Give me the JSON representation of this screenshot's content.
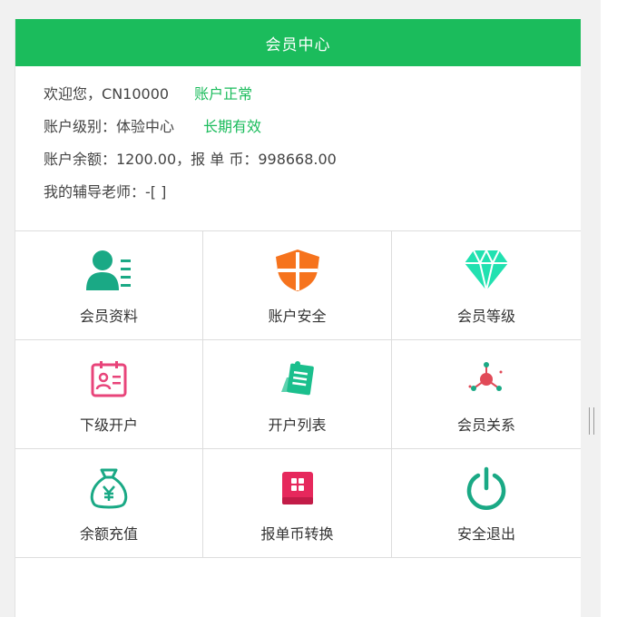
{
  "header": {
    "title": "会员中心"
  },
  "account": {
    "welcome_prefix": "欢迎您，",
    "username": "CN10000",
    "status": "账户正常",
    "level_label": "账户级别：",
    "level_value": "体验中心",
    "validity": "长期有效",
    "balance_text": "账户余额：1200.00，报 单 币：998668.00",
    "mentor_text": "我的辅导老师：-[ ]"
  },
  "menu": {
    "items": [
      {
        "label": "会员资料",
        "icon": "member-profile-icon",
        "color": "#1aa985"
      },
      {
        "label": "账户安全",
        "icon": "shield-icon",
        "color": "#f6731d"
      },
      {
        "label": "会员等级",
        "icon": "diamond-icon",
        "color": "#21e1b0"
      },
      {
        "label": "下级开户",
        "icon": "id-card-icon",
        "color": "#e8447a"
      },
      {
        "label": "开户列表",
        "icon": "notebook-list-icon",
        "color": "#1bbf8d"
      },
      {
        "label": "会员关系",
        "icon": "network-nodes-icon",
        "color": "#e14a58"
      },
      {
        "label": "余额充值",
        "icon": "money-bag-icon",
        "color": "#1aa985"
      },
      {
        "label": "报单币转换",
        "icon": "coin-exchange-icon",
        "color": "#e6285c"
      },
      {
        "label": "安全退出",
        "icon": "power-icon",
        "color": "#1aa985"
      }
    ]
  }
}
